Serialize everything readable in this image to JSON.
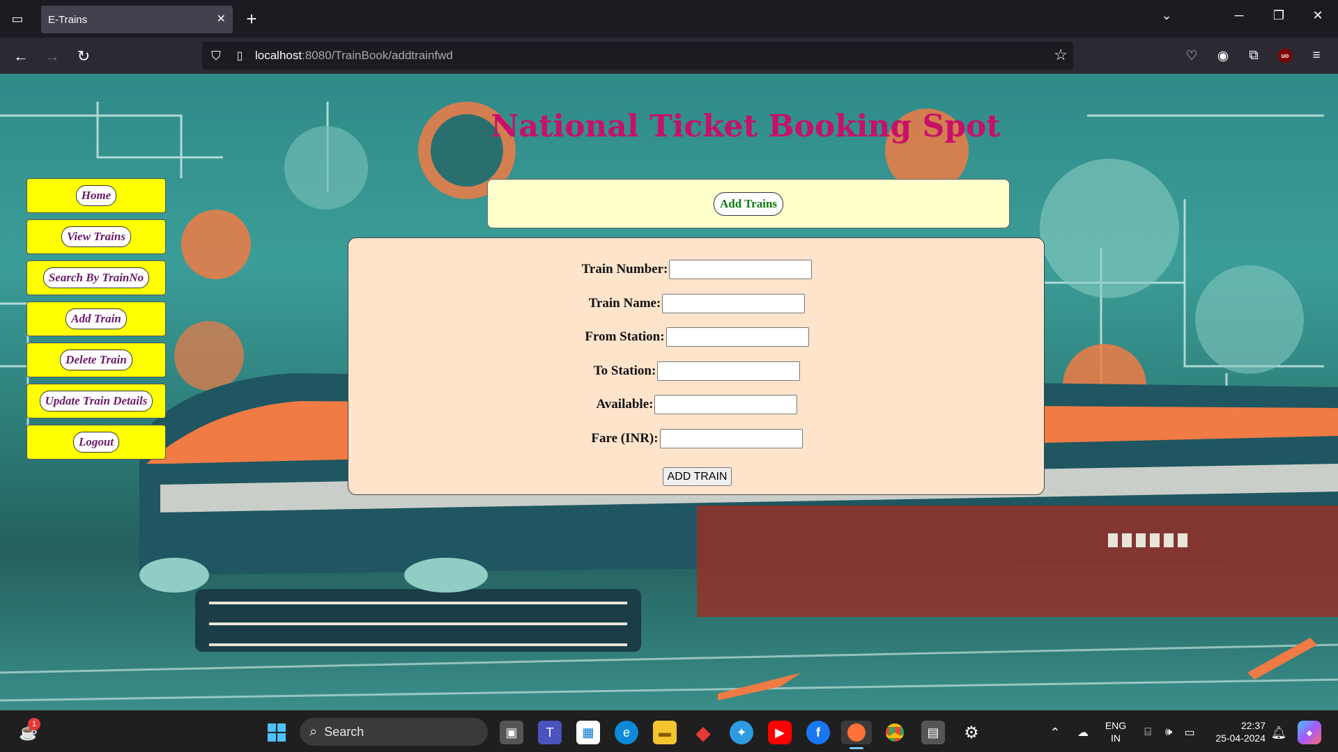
{
  "browser": {
    "tab_title": "E-Trains",
    "url_host": "localhost",
    "url_rest": ":8080/TrainBook/addtrainfwd"
  },
  "page": {
    "title": "National Ticket Booking Spot",
    "menu": [
      {
        "label": "Home"
      },
      {
        "label": "View Trains"
      },
      {
        "label": "Search By TrainNo"
      },
      {
        "label": "Add Train"
      },
      {
        "label": "Delete Train"
      },
      {
        "label": "Update Train Details"
      },
      {
        "label": "Logout"
      }
    ],
    "section_heading": "Add Trains",
    "form": {
      "fields": [
        {
          "label": "Train Number:",
          "value": ""
        },
        {
          "label": "Train Name:",
          "value": ""
        },
        {
          "label": "From Station:",
          "value": ""
        },
        {
          "label": "To Station:",
          "value": ""
        },
        {
          "label": "Available:",
          "value": ""
        },
        {
          "label": "Fare (INR):",
          "value": ""
        }
      ],
      "submit_label": "ADD TRAIN"
    }
  },
  "taskbar": {
    "search_label": "Search",
    "notification_count": "1",
    "lang_line1": "ENG",
    "lang_line2": "IN",
    "time": "22:37",
    "date": "25-04-2024"
  },
  "colors": {
    "title": "#c7106a",
    "menu_card": "#ffff00",
    "menu_text": "#6a1a6a",
    "header_box": "#ffffcc",
    "heading_text": "#0b7a0b",
    "form_box": "#ffe4cc"
  }
}
